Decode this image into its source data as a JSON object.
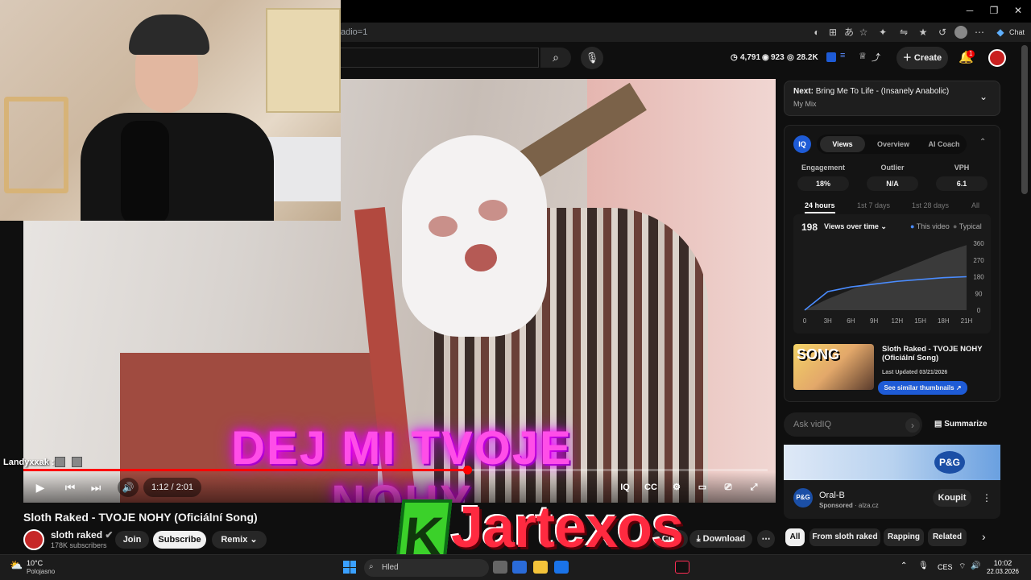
{
  "browser": {
    "url": "adio=1",
    "chat_label": "Chat"
  },
  "youtube_header": {
    "stats": [
      "4,791",
      "923",
      "28.2K"
    ],
    "create_label": "Create",
    "notif_count": "1"
  },
  "player": {
    "lyric": "DEJ MI TVOJE NOHY",
    "time": "1:12 / 2:01",
    "progress_fraction": 0.596,
    "chat_user": "Landyxxak :"
  },
  "video_info": {
    "title": "Sloth Raked - TVOJE NOHY (Oficiální Song)",
    "channel": "sloth raked",
    "subscribers": "178K subscribers",
    "join_label": "Join",
    "subscribe_label": "Subscribe",
    "remix_label": "Remix",
    "clip_label": "Clip",
    "download_label": "Download"
  },
  "next_up": {
    "label": "Next:",
    "title": "Bring Me To Life - (Insanely Anabolic)",
    "subtitle": "My Mix"
  },
  "vidiq": {
    "logo": "IQ",
    "tabs": [
      "Views",
      "Overview",
      "AI Coach"
    ],
    "metrics": [
      {
        "label": "Engagement",
        "value": "18%"
      },
      {
        "label": "Outlier",
        "value": "N/A"
      },
      {
        "label": "VPH",
        "value": "6.1"
      }
    ],
    "ranges": [
      "24 hours",
      "1st 7 days",
      "1st 28 days",
      "All"
    ],
    "views": "198",
    "views_over_time": "Views over time",
    "legend_this": "This video",
    "legend_typical": "Typical",
    "thumb_text": "SONG",
    "thumb_title": "Sloth Raked - TVOJE NOHY (Oficiální Song)",
    "last_updated": "Last Updated 03/21/2026",
    "see_similar": "See similar thumbnails",
    "ask_placeholder": "Ask vidIQ",
    "summarize": "Summarize"
  },
  "chart_data": {
    "type": "area",
    "x": [
      "0",
      "3H",
      "6H",
      "9H",
      "12H",
      "15H",
      "18H",
      "21H"
    ],
    "ylim": [
      0,
      360
    ],
    "y_ticks": [
      "0",
      "90",
      "180",
      "270",
      "360"
    ],
    "series": [
      {
        "name": "This video",
        "values": [
          0,
          100,
          125,
          140,
          155,
          165,
          175,
          180
        ]
      },
      {
        "name": "Typical",
        "values": [
          0,
          60,
          110,
          160,
          210,
          260,
          310,
          350
        ]
      }
    ]
  },
  "ad": {
    "brand_logo": "P&G",
    "title": "Oral-B",
    "sponsored": "Sponsored",
    "domain": "alza.cz",
    "cta": "Koupit"
  },
  "chips": [
    "All",
    "From sloth raked",
    "Rapping",
    "Related"
  ],
  "overlay_logo": {
    "k": "K",
    "rest": "Jartexos"
  },
  "taskbar": {
    "temp": "10°C",
    "weather": "Polojasno",
    "search": "Hled",
    "lang": "CES",
    "time": "10:02",
    "date": "22.03.2026"
  }
}
